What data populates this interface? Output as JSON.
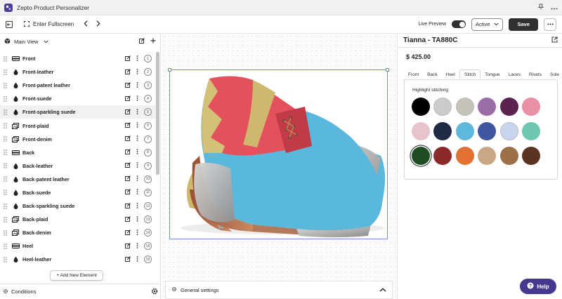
{
  "window": {
    "title": "Zepto Product Personalizer"
  },
  "toolbar": {
    "fullscreen_label": "Enter Fullscreen",
    "live_preview_label": "Live Preview",
    "status_value": "Active",
    "save_label": "Save"
  },
  "sidebar": {
    "view_label": "Main View",
    "add_element_label": "+ Add New Element",
    "conditions_label": "Conditions",
    "layers": [
      {
        "name": "Front",
        "number": "1",
        "type": "bar-icon"
      },
      {
        "name": "Front-leather",
        "number": "2",
        "type": "drop-icon"
      },
      {
        "name": "Front-patent leather",
        "number": "3",
        "type": "drop-icon"
      },
      {
        "name": "Front-suede",
        "number": "4",
        "type": "drop-icon"
      },
      {
        "name": "Front-sparkling suede",
        "number": "5",
        "type": "drop-icon"
      },
      {
        "name": "Front-plaid",
        "number": "6",
        "type": "image-icon"
      },
      {
        "name": "Front-denim",
        "number": "7",
        "type": "image-icon"
      },
      {
        "name": "Back",
        "number": "8",
        "type": "bar-icon"
      },
      {
        "name": "Back-leather",
        "number": "9",
        "type": "drop-icon"
      },
      {
        "name": "Back-patent leather",
        "number": "10",
        "type": "drop-icon"
      },
      {
        "name": "Back-suede",
        "number": "11",
        "type": "drop-icon"
      },
      {
        "name": "Back-sparkling suede",
        "number": "12",
        "type": "drop-icon"
      },
      {
        "name": "Back-plaid",
        "number": "13",
        "type": "image-icon"
      },
      {
        "name": "Back-denim",
        "number": "14",
        "type": "image-icon"
      },
      {
        "name": "Heel",
        "number": "15",
        "type": "bar-icon"
      },
      {
        "name": "Heel-leather",
        "number": "16",
        "type": "drop-icon"
      }
    ]
  },
  "canvas": {
    "general_settings_label": "General settings"
  },
  "panel": {
    "product_title": "Tianna - TA880C",
    "price": "$ 425.00",
    "tabs": [
      "Front",
      "Back",
      "Heel",
      "Stitch",
      "Tongue",
      "Laces",
      "Rivets",
      "Sole"
    ],
    "active_tab": "Stitch",
    "section_label": "Highlight stitching",
    "swatches": [
      "#000000",
      "#cbcbcb",
      "#c5c3b8",
      "#9b6da6",
      "#5c2350",
      "#e790a6",
      "#e7c4cb",
      "#1f2b45",
      "#5db8db",
      "#3f57a0",
      "#c9d5ee",
      "#6dc7b0",
      "#1e4d23",
      "#8b2a2b",
      "#e27032",
      "#c9a785",
      "#9c7048",
      "#5b3323"
    ],
    "selected_swatch": "#1e4d23"
  },
  "help": {
    "label": "Help"
  },
  "colors": {
    "accent": "#303030",
    "help": "#46378f",
    "selection": "#6b8fd6"
  }
}
